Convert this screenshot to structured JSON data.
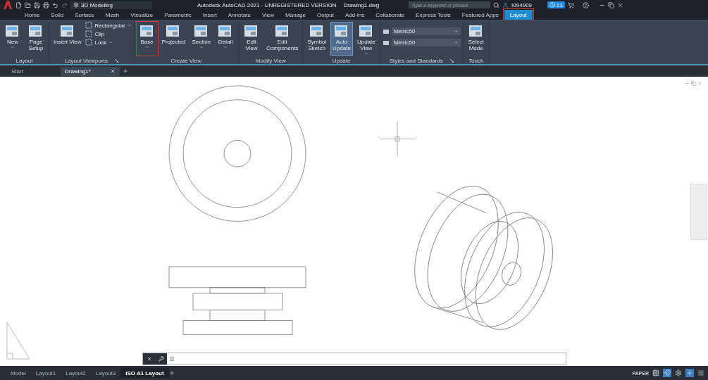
{
  "title_bar": {
    "workspace": "3D Modeling",
    "title": "Autodesk AutoCAD 2021 - UNREGISTERED VERSION",
    "file": "Drawing1.dwg",
    "search": {
      "placeholder": "Type a keyword or phrase"
    },
    "user": "I094909",
    "notifications": "21"
  },
  "ribbon_tabs": [
    {
      "label": "Home",
      "selected": false,
      "highlighted": false
    },
    {
      "label": "Solid",
      "selected": false,
      "highlighted": false
    },
    {
      "label": "Surface",
      "selected": false,
      "highlighted": false
    },
    {
      "label": "Mesh",
      "selected": false,
      "highlighted": false
    },
    {
      "label": "Visualize",
      "selected": false,
      "highlighted": false
    },
    {
      "label": "Parametric",
      "selected": false,
      "highlighted": false
    },
    {
      "label": "Insert",
      "selected": false,
      "highlighted": false
    },
    {
      "label": "Annotate",
      "selected": false,
      "highlighted": false
    },
    {
      "label": "View",
      "selected": false,
      "highlighted": false
    },
    {
      "label": "Manage",
      "selected": false,
      "highlighted": false
    },
    {
      "label": "Output",
      "selected": false,
      "highlighted": false
    },
    {
      "label": "Add-ins",
      "selected": false,
      "highlighted": false
    },
    {
      "label": "Collaborate",
      "selected": false,
      "highlighted": false
    },
    {
      "label": "Express Tools",
      "selected": false,
      "highlighted": false
    },
    {
      "label": "Featured Apps",
      "selected": false,
      "highlighted": false
    },
    {
      "label": "Layout",
      "selected": true,
      "highlighted": true
    }
  ],
  "ribbon_panels": [
    {
      "title": "Layout",
      "launcher": false,
      "items": [
        {
          "kind": "large",
          "label": "New",
          "dropdown": true,
          "active": false,
          "highlighted": false
        },
        {
          "kind": "large",
          "label": "Page\nSetup",
          "dropdown": false,
          "active": false,
          "highlighted": false
        }
      ]
    },
    {
      "title": "Layout Viewports",
      "launcher": true,
      "items": [
        {
          "kind": "large",
          "label": "Insert View",
          "dropdown": false,
          "active": false,
          "highlighted": false
        },
        {
          "kind": "stack",
          "entries": [
            {
              "label": "Rectangular",
              "dropdown": true
            },
            {
              "label": "Clip",
              "dropdown": false
            },
            {
              "label": "Lock",
              "dropdown": true
            }
          ]
        }
      ]
    },
    {
      "title": "Create View",
      "launcher": false,
      "items": [
        {
          "kind": "large",
          "label": "Base",
          "dropdown": true,
          "active": false,
          "highlighted": true
        },
        {
          "kind": "large",
          "label": "Projected",
          "dropdown": false,
          "active": false,
          "highlighted": false
        },
        {
          "kind": "large",
          "label": "Section",
          "dropdown": true,
          "active": false,
          "highlighted": false
        },
        {
          "kind": "large",
          "label": "Detail",
          "dropdown": true,
          "active": false,
          "highlighted": false
        }
      ]
    },
    {
      "title": "Modify View",
      "launcher": false,
      "items": [
        {
          "kind": "large",
          "label": "Edit\nView",
          "dropdown": false,
          "active": false,
          "highlighted": false
        },
        {
          "kind": "large",
          "label": "Edit\nComponents",
          "dropdown": false,
          "active": false,
          "highlighted": false
        }
      ]
    },
    {
      "title": "Update",
      "launcher": false,
      "items": [
        {
          "kind": "large",
          "label": "Symbol\nSketch",
          "dropdown": false,
          "active": false,
          "highlighted": false
        },
        {
          "kind": "large",
          "label": "Auto\nUpdate",
          "dropdown": false,
          "active": true,
          "highlighted": false
        },
        {
          "kind": "large",
          "label": "Update\nView",
          "dropdown": true,
          "active": false,
          "highlighted": false
        }
      ]
    },
    {
      "title": "Styles and Standards",
      "launcher": true,
      "items": [
        {
          "kind": "selects",
          "values": [
            "Metric50",
            "Metric50"
          ]
        }
      ]
    },
    {
      "title": "Touch",
      "launcher": false,
      "items": [
        {
          "kind": "large",
          "label": "Select\nMode",
          "dropdown": false,
          "active": false,
          "highlighted": false
        }
      ]
    }
  ],
  "doc_tabs": [
    {
      "label": "Start",
      "selected": false,
      "closable": false
    },
    {
      "label": "Drawing1*",
      "selected": true,
      "closable": true
    }
  ],
  "layout_tabs": [
    {
      "label": "Model",
      "selected": false
    },
    {
      "label": "Layout1",
      "selected": false
    },
    {
      "label": "Layout2",
      "selected": false
    },
    {
      "label": "Layout3",
      "selected": false
    },
    {
      "label": "ISO A1 Layout",
      "selected": true
    }
  ],
  "status_bar": {
    "space": "PAPER"
  }
}
